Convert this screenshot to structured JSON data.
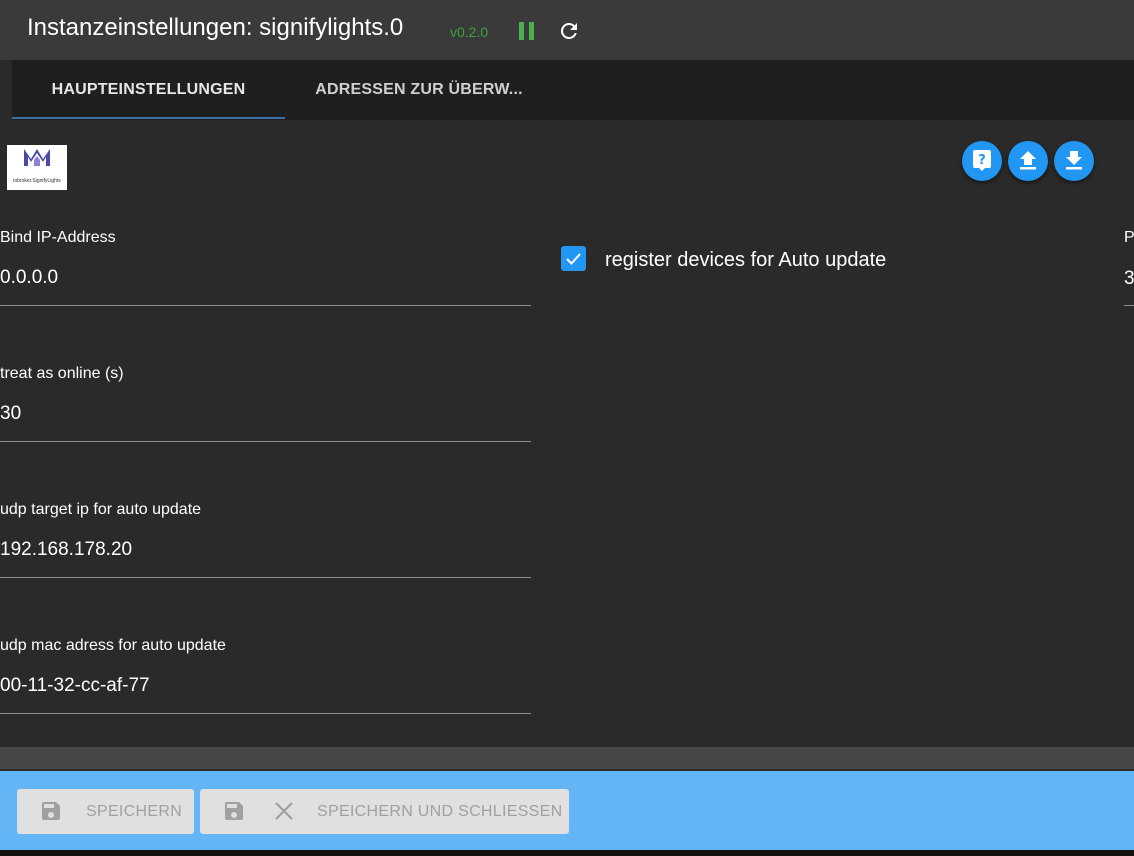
{
  "header": {
    "title": "Instanzeinstellungen: signifylights.0",
    "version": "v0.2.0",
    "pause_icon": "pause-icon",
    "reload_icon": "reload-icon"
  },
  "tabs": [
    {
      "label": "HAUPTEINSTELLUNGEN",
      "active": true
    },
    {
      "label": "ADRESSEN ZUR ÜBERW..."
    }
  ],
  "logo": {
    "text": "iobroker.SignifyLights"
  },
  "toolbar": {
    "help_icon": "help-icon",
    "upload_icon": "upload-icon",
    "download_icon": "download-icon"
  },
  "fields": {
    "bind_ip": {
      "label": "Bind IP-Address",
      "value": "0.0.0.0"
    },
    "online": {
      "label": "treat as online (s)",
      "value": "30"
    },
    "udp_ip": {
      "label": "udp target ip for auto update",
      "value": "192.168.178.20"
    },
    "udp_mac": {
      "label": "udp mac adress for auto update",
      "value": "00-11-32-cc-af-77"
    },
    "right_partial": {
      "label": "P",
      "value": "3"
    }
  },
  "checkbox": {
    "label": "register devices for Auto update",
    "checked": true
  },
  "footer": {
    "save_label": "SPEICHERN",
    "save_close_label": "SPEICHERN UND SCHLIESSEN"
  },
  "colors": {
    "accent": "#2196f3",
    "footer": "#64b5f6",
    "version": "#3ea23a"
  }
}
